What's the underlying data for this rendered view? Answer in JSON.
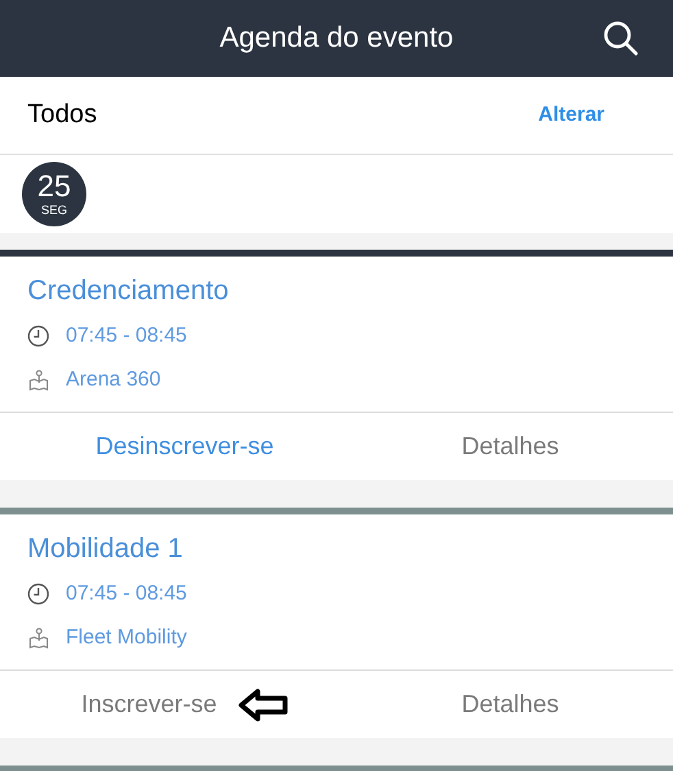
{
  "header": {
    "title": "Agenda do evento"
  },
  "filter": {
    "label": "Todos",
    "action": "Alterar"
  },
  "dates": [
    {
      "day": "25",
      "weekday": "SEG",
      "selected": true
    }
  ],
  "events": [
    {
      "title": "Credenciamento",
      "time": "07:45 - 08:45",
      "location": "Arena 360",
      "color": "#2b3440",
      "subscribed": true,
      "subscribe_label": "Desinscrever-se",
      "details_label": "Detalhes",
      "arrow_marker": false
    },
    {
      "title": "Mobilidade 1",
      "time": "07:45 - 08:45",
      "location": "Fleet Mobility",
      "color": "#7d8f8f",
      "subscribed": false,
      "subscribe_label": "Inscrever-se",
      "details_label": "Detalhes",
      "arrow_marker": true
    }
  ]
}
